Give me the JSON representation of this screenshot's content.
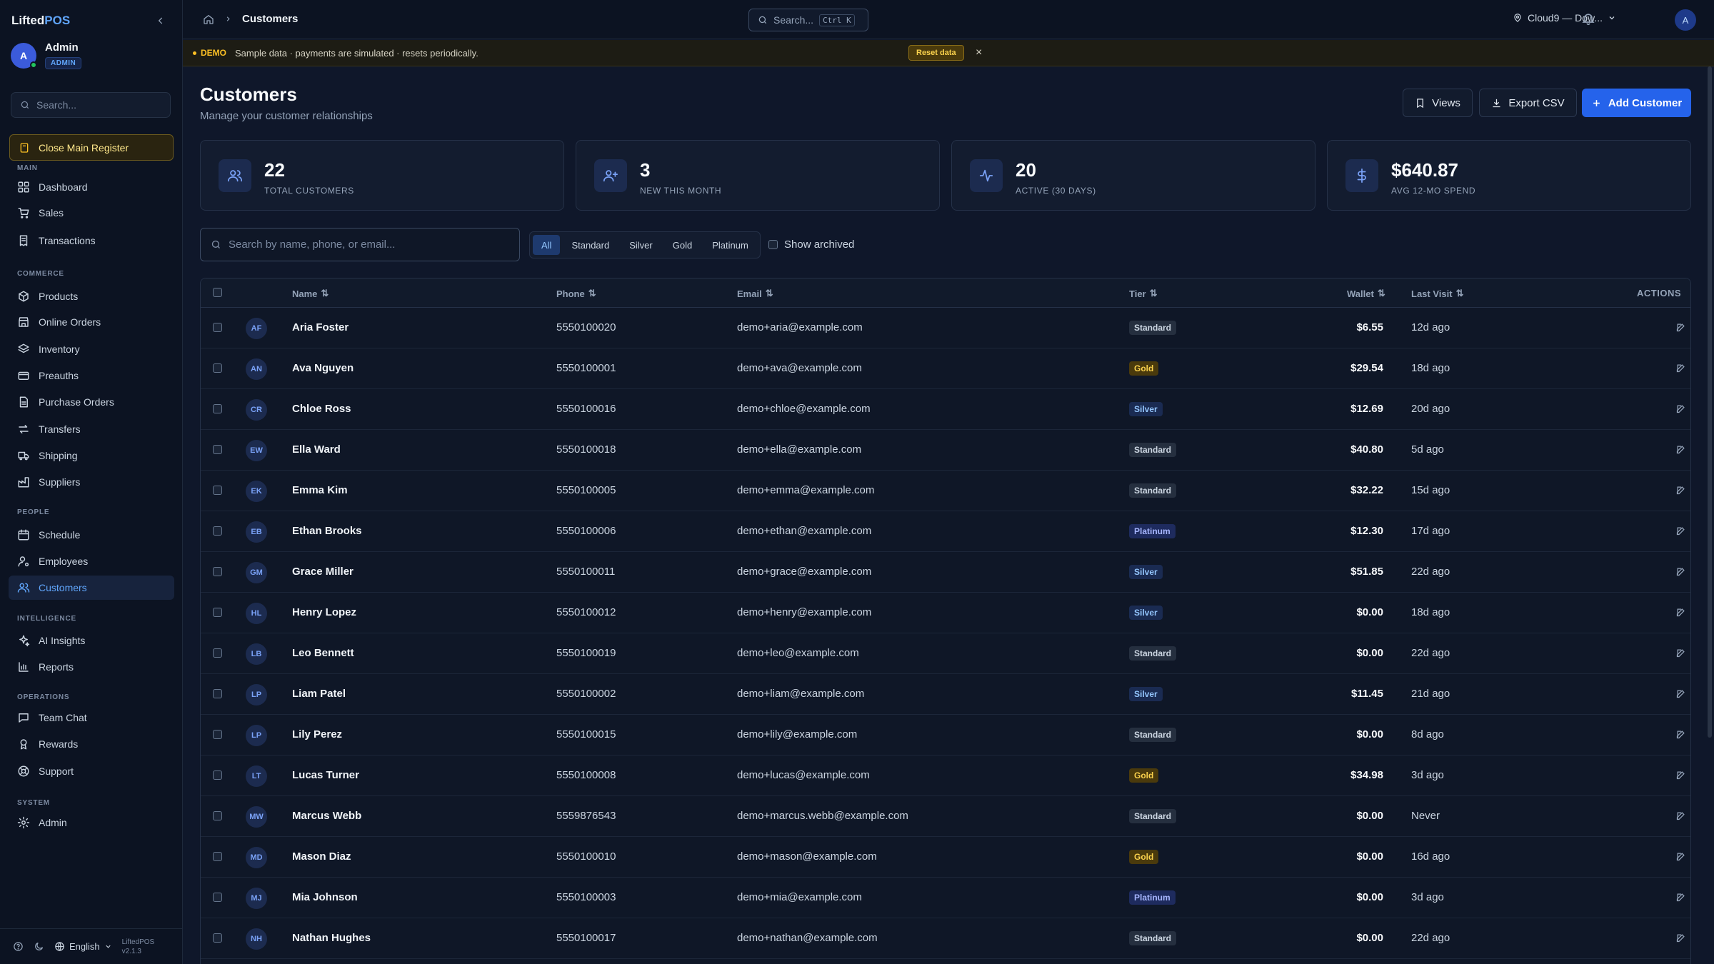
{
  "app": {
    "brand_prefix": "Lifted",
    "brand_suffix": "POS"
  },
  "user": {
    "initial": "A",
    "name": "Admin",
    "role": "ADMIN"
  },
  "sidebar": {
    "search_placeholder": "Search...",
    "register_label": "Close Main Register",
    "sections": [
      "MAIN",
      "COMMERCE",
      "PEOPLE",
      "INTELLIGENCE",
      "OPERATIONS",
      "SYSTEM"
    ],
    "items": [
      {
        "label": "Dashboard",
        "icon": "dashboard-icon"
      },
      {
        "label": "Sales",
        "icon": "cart-icon"
      },
      {
        "label": "Transactions",
        "icon": "receipt-icon"
      },
      {
        "label": "Products",
        "icon": "box-icon"
      },
      {
        "label": "Online Orders",
        "icon": "store-icon"
      },
      {
        "label": "Inventory",
        "icon": "layers-icon"
      },
      {
        "label": "Preauths",
        "icon": "card-icon"
      },
      {
        "label": "Purchase Orders",
        "icon": "file-icon"
      },
      {
        "label": "Transfers",
        "icon": "transfer-icon"
      },
      {
        "label": "Shipping",
        "icon": "truck-icon"
      },
      {
        "label": "Suppliers",
        "icon": "factory-icon"
      },
      {
        "label": "Schedule",
        "icon": "calendar-icon"
      },
      {
        "label": "Employees",
        "icon": "user-cog-icon"
      },
      {
        "label": "Customers",
        "icon": "users-icon",
        "active": true
      },
      {
        "label": "AI Insights",
        "icon": "sparkles-icon"
      },
      {
        "label": "Reports",
        "icon": "bar-chart-icon"
      },
      {
        "label": "Team Chat",
        "icon": "chat-icon"
      },
      {
        "label": "Rewards",
        "icon": "award-icon"
      },
      {
        "label": "Support",
        "icon": "lifebuoy-icon"
      },
      {
        "label": "Admin",
        "icon": "gear-icon"
      }
    ],
    "footer": {
      "language": "English",
      "app_name": "LiftedPOS",
      "version": "v2.1.3"
    }
  },
  "topbar": {
    "breadcrumb_current": "Customers",
    "search_placeholder": "Search...",
    "search_shortcut": "Ctrl K",
    "location": "Cloud9 — Dow...",
    "avatar_initial": "A"
  },
  "banner": {
    "tag": "DEMO",
    "text": "Sample data · payments are simulated · resets periodically.",
    "reset_label": "Reset data",
    "close": "×"
  },
  "page": {
    "title": "Customers",
    "subtitle": "Manage your customer relationships",
    "views_label": "Views",
    "export_label": "Export CSV",
    "add_label": "Add Customer"
  },
  "stats": [
    {
      "value": "22",
      "label": "TOTAL CUSTOMERS",
      "icon": "users-icon"
    },
    {
      "value": "3",
      "label": "NEW THIS MONTH",
      "icon": "user-plus-icon"
    },
    {
      "value": "20",
      "label": "ACTIVE (30 DAYS)",
      "icon": "activity-icon"
    },
    {
      "value": "$640.87",
      "label": "AVG 12-MO SPEND",
      "icon": "dollar-icon"
    }
  ],
  "filters": {
    "search_placeholder": "Search by name, phone, or email...",
    "tiers": [
      "All",
      "Standard",
      "Silver",
      "Gold",
      "Platinum"
    ],
    "selected_tier": "All",
    "show_archived_label": "Show archived"
  },
  "table": {
    "columns": {
      "name": "Name",
      "phone": "Phone",
      "email": "Email",
      "tier": "Tier",
      "wallet": "Wallet",
      "last_visit": "Last Visit",
      "actions": "ACTIONS"
    },
    "rows": [
      {
        "initials": "AF",
        "name": "Aria Foster",
        "phone": "5550100020",
        "email": "demo+aria@example.com",
        "tier": "Standard",
        "wallet": "$6.55",
        "last_visit": "12d ago"
      },
      {
        "initials": "AN",
        "name": "Ava Nguyen",
        "phone": "5550100001",
        "email": "demo+ava@example.com",
        "tier": "Gold",
        "wallet": "$29.54",
        "last_visit": "18d ago"
      },
      {
        "initials": "CR",
        "name": "Chloe Ross",
        "phone": "5550100016",
        "email": "demo+chloe@example.com",
        "tier": "Silver",
        "wallet": "$12.69",
        "last_visit": "20d ago"
      },
      {
        "initials": "EW",
        "name": "Ella Ward",
        "phone": "5550100018",
        "email": "demo+ella@example.com",
        "tier": "Standard",
        "wallet": "$40.80",
        "last_visit": "5d ago"
      },
      {
        "initials": "EK",
        "name": "Emma Kim",
        "phone": "5550100005",
        "email": "demo+emma@example.com",
        "tier": "Standard",
        "wallet": "$32.22",
        "last_visit": "15d ago"
      },
      {
        "initials": "EB",
        "name": "Ethan Brooks",
        "phone": "5550100006",
        "email": "demo+ethan@example.com",
        "tier": "Platinum",
        "wallet": "$12.30",
        "last_visit": "17d ago"
      },
      {
        "initials": "GM",
        "name": "Grace Miller",
        "phone": "5550100011",
        "email": "demo+grace@example.com",
        "tier": "Silver",
        "wallet": "$51.85",
        "last_visit": "22d ago"
      },
      {
        "initials": "HL",
        "name": "Henry Lopez",
        "phone": "5550100012",
        "email": "demo+henry@example.com",
        "tier": "Silver",
        "wallet": "$0.00",
        "last_visit": "18d ago"
      },
      {
        "initials": "LB",
        "name": "Leo Bennett",
        "phone": "5550100019",
        "email": "demo+leo@example.com",
        "tier": "Standard",
        "wallet": "$0.00",
        "last_visit": "22d ago"
      },
      {
        "initials": "LP",
        "name": "Liam Patel",
        "phone": "5550100002",
        "email": "demo+liam@example.com",
        "tier": "Silver",
        "wallet": "$11.45",
        "last_visit": "21d ago"
      },
      {
        "initials": "LP",
        "name": "Lily Perez",
        "phone": "5550100015",
        "email": "demo+lily@example.com",
        "tier": "Standard",
        "wallet": "$0.00",
        "last_visit": "8d ago"
      },
      {
        "initials": "LT",
        "name": "Lucas Turner",
        "phone": "5550100008",
        "email": "demo+lucas@example.com",
        "tier": "Gold",
        "wallet": "$34.98",
        "last_visit": "3d ago"
      },
      {
        "initials": "MW",
        "name": "Marcus Webb",
        "phone": "5559876543",
        "email": "demo+marcus.webb@example.com",
        "tier": "Standard",
        "wallet": "$0.00",
        "last_visit": "Never"
      },
      {
        "initials": "MD",
        "name": "Mason Diaz",
        "phone": "5550100010",
        "email": "demo+mason@example.com",
        "tier": "Gold",
        "wallet": "$0.00",
        "last_visit": "16d ago"
      },
      {
        "initials": "MJ",
        "name": "Mia Johnson",
        "phone": "5550100003",
        "email": "demo+mia@example.com",
        "tier": "Platinum",
        "wallet": "$0.00",
        "last_visit": "3d ago"
      },
      {
        "initials": "NH",
        "name": "Nathan Hughes",
        "phone": "5550100017",
        "email": "demo+nathan@example.com",
        "tier": "Standard",
        "wallet": "$0.00",
        "last_visit": "22d ago"
      }
    ]
  }
}
